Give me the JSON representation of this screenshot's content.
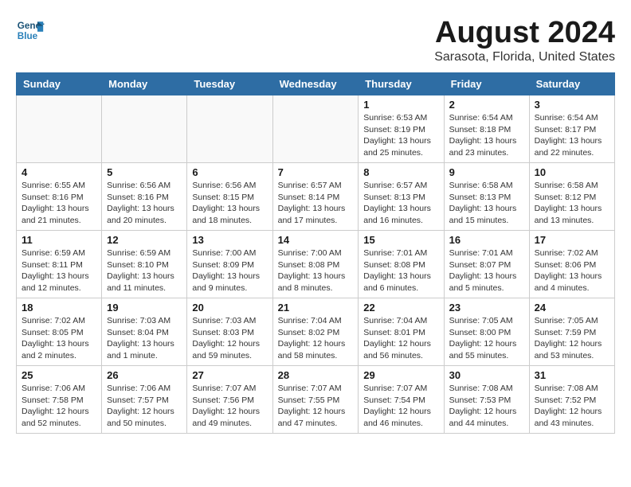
{
  "logo": {
    "line1": "General",
    "line2": "Blue"
  },
  "title": "August 2024",
  "location": "Sarasota, Florida, United States",
  "weekdays": [
    "Sunday",
    "Monday",
    "Tuesday",
    "Wednesday",
    "Thursday",
    "Friday",
    "Saturday"
  ],
  "weeks": [
    [
      {
        "day": "",
        "info": ""
      },
      {
        "day": "",
        "info": ""
      },
      {
        "day": "",
        "info": ""
      },
      {
        "day": "",
        "info": ""
      },
      {
        "day": "1",
        "info": "Sunrise: 6:53 AM\nSunset: 8:19 PM\nDaylight: 13 hours\nand 25 minutes."
      },
      {
        "day": "2",
        "info": "Sunrise: 6:54 AM\nSunset: 8:18 PM\nDaylight: 13 hours\nand 23 minutes."
      },
      {
        "day": "3",
        "info": "Sunrise: 6:54 AM\nSunset: 8:17 PM\nDaylight: 13 hours\nand 22 minutes."
      }
    ],
    [
      {
        "day": "4",
        "info": "Sunrise: 6:55 AM\nSunset: 8:16 PM\nDaylight: 13 hours\nand 21 minutes."
      },
      {
        "day": "5",
        "info": "Sunrise: 6:56 AM\nSunset: 8:16 PM\nDaylight: 13 hours\nand 20 minutes."
      },
      {
        "day": "6",
        "info": "Sunrise: 6:56 AM\nSunset: 8:15 PM\nDaylight: 13 hours\nand 18 minutes."
      },
      {
        "day": "7",
        "info": "Sunrise: 6:57 AM\nSunset: 8:14 PM\nDaylight: 13 hours\nand 17 minutes."
      },
      {
        "day": "8",
        "info": "Sunrise: 6:57 AM\nSunset: 8:13 PM\nDaylight: 13 hours\nand 16 minutes."
      },
      {
        "day": "9",
        "info": "Sunrise: 6:58 AM\nSunset: 8:13 PM\nDaylight: 13 hours\nand 15 minutes."
      },
      {
        "day": "10",
        "info": "Sunrise: 6:58 AM\nSunset: 8:12 PM\nDaylight: 13 hours\nand 13 minutes."
      }
    ],
    [
      {
        "day": "11",
        "info": "Sunrise: 6:59 AM\nSunset: 8:11 PM\nDaylight: 13 hours\nand 12 minutes."
      },
      {
        "day": "12",
        "info": "Sunrise: 6:59 AM\nSunset: 8:10 PM\nDaylight: 13 hours\nand 11 minutes."
      },
      {
        "day": "13",
        "info": "Sunrise: 7:00 AM\nSunset: 8:09 PM\nDaylight: 13 hours\nand 9 minutes."
      },
      {
        "day": "14",
        "info": "Sunrise: 7:00 AM\nSunset: 8:08 PM\nDaylight: 13 hours\nand 8 minutes."
      },
      {
        "day": "15",
        "info": "Sunrise: 7:01 AM\nSunset: 8:08 PM\nDaylight: 13 hours\nand 6 minutes."
      },
      {
        "day": "16",
        "info": "Sunrise: 7:01 AM\nSunset: 8:07 PM\nDaylight: 13 hours\nand 5 minutes."
      },
      {
        "day": "17",
        "info": "Sunrise: 7:02 AM\nSunset: 8:06 PM\nDaylight: 13 hours\nand 4 minutes."
      }
    ],
    [
      {
        "day": "18",
        "info": "Sunrise: 7:02 AM\nSunset: 8:05 PM\nDaylight: 13 hours\nand 2 minutes."
      },
      {
        "day": "19",
        "info": "Sunrise: 7:03 AM\nSunset: 8:04 PM\nDaylight: 13 hours\nand 1 minute."
      },
      {
        "day": "20",
        "info": "Sunrise: 7:03 AM\nSunset: 8:03 PM\nDaylight: 12 hours\nand 59 minutes."
      },
      {
        "day": "21",
        "info": "Sunrise: 7:04 AM\nSunset: 8:02 PM\nDaylight: 12 hours\nand 58 minutes."
      },
      {
        "day": "22",
        "info": "Sunrise: 7:04 AM\nSunset: 8:01 PM\nDaylight: 12 hours\nand 56 minutes."
      },
      {
        "day": "23",
        "info": "Sunrise: 7:05 AM\nSunset: 8:00 PM\nDaylight: 12 hours\nand 55 minutes."
      },
      {
        "day": "24",
        "info": "Sunrise: 7:05 AM\nSunset: 7:59 PM\nDaylight: 12 hours\nand 53 minutes."
      }
    ],
    [
      {
        "day": "25",
        "info": "Sunrise: 7:06 AM\nSunset: 7:58 PM\nDaylight: 12 hours\nand 52 minutes."
      },
      {
        "day": "26",
        "info": "Sunrise: 7:06 AM\nSunset: 7:57 PM\nDaylight: 12 hours\nand 50 minutes."
      },
      {
        "day": "27",
        "info": "Sunrise: 7:07 AM\nSunset: 7:56 PM\nDaylight: 12 hours\nand 49 minutes."
      },
      {
        "day": "28",
        "info": "Sunrise: 7:07 AM\nSunset: 7:55 PM\nDaylight: 12 hours\nand 47 minutes."
      },
      {
        "day": "29",
        "info": "Sunrise: 7:07 AM\nSunset: 7:54 PM\nDaylight: 12 hours\nand 46 minutes."
      },
      {
        "day": "30",
        "info": "Sunrise: 7:08 AM\nSunset: 7:53 PM\nDaylight: 12 hours\nand 44 minutes."
      },
      {
        "day": "31",
        "info": "Sunrise: 7:08 AM\nSunset: 7:52 PM\nDaylight: 12 hours\nand 43 minutes."
      }
    ]
  ]
}
